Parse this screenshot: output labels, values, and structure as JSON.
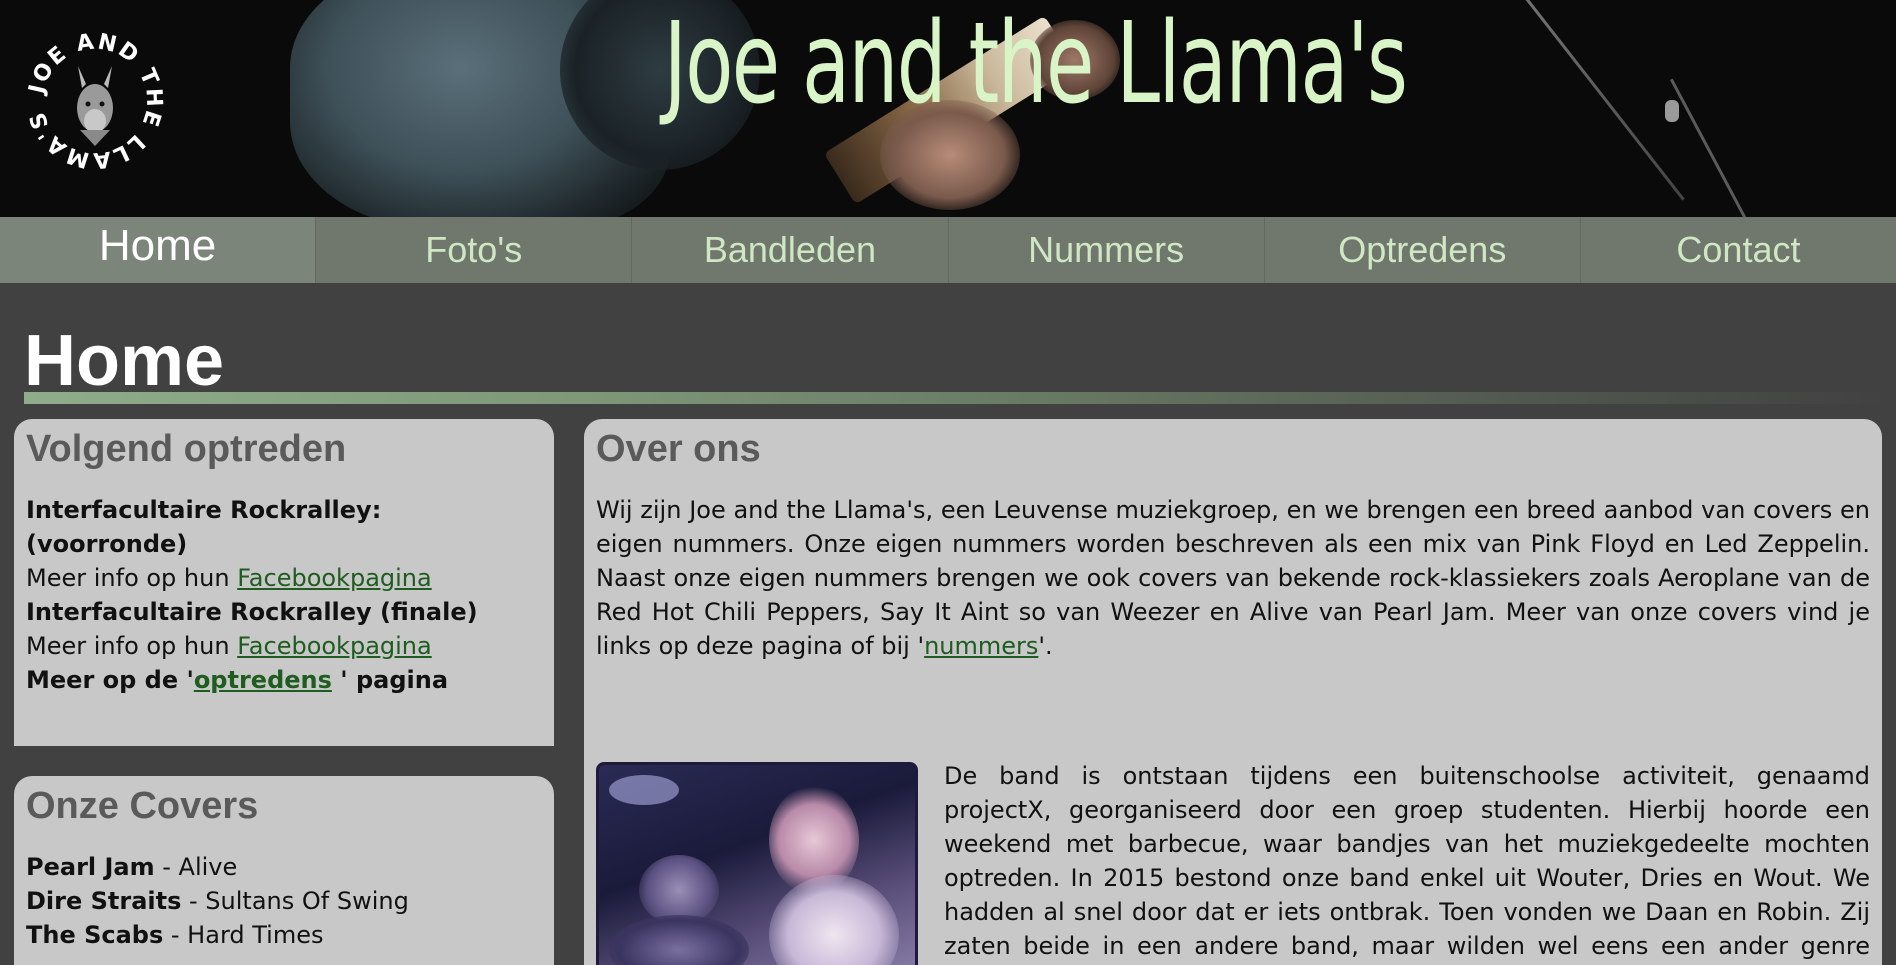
{
  "header": {
    "title": "Joe and the Llama's",
    "logo_text": "JOE AND THE LLAMA'S"
  },
  "nav": {
    "items": [
      {
        "label": "Home",
        "active": true
      },
      {
        "label": "Foto's"
      },
      {
        "label": "Bandleden"
      },
      {
        "label": "Nummers"
      },
      {
        "label": "Optredens"
      },
      {
        "label": "Contact"
      }
    ]
  },
  "page": {
    "title": "Home"
  },
  "next_gig": {
    "heading": "Volgend optreden",
    "event1_title": "Interfacultaire Rockralley: (voorronde)",
    "event1_info": "Meer info op hun ",
    "event1_link": "Facebookpagina",
    "event2_title": "Interfacultaire Rockralley (finale)",
    "event2_info": "Meer info op hun ",
    "event2_link": "Facebookpagina",
    "more_prefix": "Meer op de '",
    "more_link": "optredens",
    "more_suffix": " ' pagina"
  },
  "covers": {
    "heading": "Onze Covers",
    "items": [
      {
        "artist": "Pearl Jam",
        "song": " - Alive"
      },
      {
        "artist": "Dire Straits",
        "song": " - Sultans Of Swing"
      },
      {
        "artist": "The Scabs",
        "song": " - Hard Times"
      }
    ]
  },
  "about": {
    "heading": "Over ons",
    "para1": "Wij zijn Joe and the Llama's, een Leuvense muziekgroep, en we brengen een breed aanbod van covers en eigen nummers. Onze eigen nummers worden beschreven als een mix van Pink Floyd en Led Zeppelin. Naast onze eigen nummers brengen we ook covers van bekende rock-klassiekers zoals Aeroplane van de Red Hot Chili Peppers, Say It Aint so van Weezer en Alive van Pearl Jam. Meer van onze covers vind je links op deze pagina of bij '",
    "para1_link": "nummers",
    "para1_end": "'.",
    "para2": "De band is ontstaan tijdens een buitenschoolse activiteit, genaamd projectX, georganiseerd door een groep studenten. Hierbij hoorde een weekend met barbecue, waar bandjes van het muziekgedeelte mochten optreden. In 2015 bestond onze band enkel uit Wouter, Dries en Wout. We hadden al snel door dat er iets ontbrak. Toen vonden we Daan en Robin. Zij zaten beide in een andere band, maar wilden wel eens een ander genre spelen. Ze pasten perfect"
  }
}
